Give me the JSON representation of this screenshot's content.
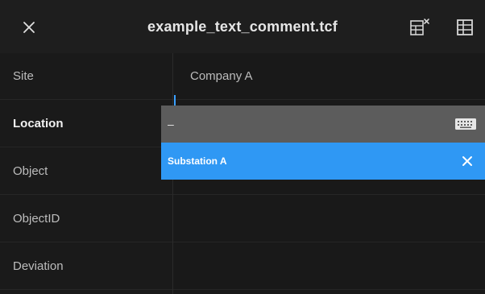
{
  "header": {
    "title": "example_text_comment.tcf",
    "close_icon": "close-icon",
    "clear_form_icon": "clear-form-icon",
    "table_view_icon": "table-view-icon"
  },
  "fields": [
    {
      "label": "Site",
      "value": "Company A"
    },
    {
      "label": "Location",
      "value": ""
    },
    {
      "label": "Object",
      "value": ""
    },
    {
      "label": "ObjectID",
      "value": ""
    },
    {
      "label": "Deviation",
      "value": ""
    }
  ],
  "editor": {
    "input_value": "–",
    "keyboard_icon": "keyboard-icon",
    "suggestion": "Substation A",
    "suggestion_clear_icon": "close-icon"
  },
  "colors": {
    "background": "#1b1b1b",
    "edit_bar": "#5c5c5c",
    "suggestion_accent": "#2f98f4",
    "cursor": "#3aa0ff"
  }
}
